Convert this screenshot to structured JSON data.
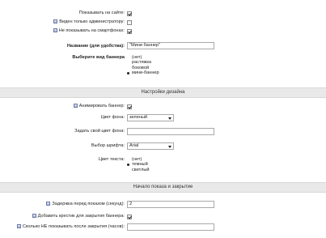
{
  "general": {
    "show_on_site_label": "Показывать на сайте:",
    "admin_only_label": "Виден только администратору:",
    "hide_on_phones_label": "Не показывать на смартфонах:",
    "name_label": "Название (для удобства):",
    "name_value": "\"Мини баннер\"",
    "banner_type_label": "Выберите вид баннера",
    "banner_type_options": [
      "(нет)",
      "растяжка",
      "боковой",
      "мини-баннер"
    ],
    "banner_type_selected": "мини-баннер"
  },
  "design": {
    "section_title": "Настройки дизайна",
    "animate_label": "Анимировать баннер:",
    "bg_color_label": "Цвет фона:",
    "bg_color_value": "зеленый",
    "custom_bg_label": "Задать свой цвет фона:",
    "custom_bg_value": "",
    "font_label": "Выбор шрифта:",
    "font_value": "Arial",
    "text_color_label": "Цвет текста:",
    "text_color_options": [
      "(нет)",
      "темный",
      "светлый"
    ],
    "text_color_selected": "темный"
  },
  "timing": {
    "section_title": "Начало показа и закрытие",
    "delay_label": "Задержка перед показом (секунд):",
    "delay_value": "2",
    "close_cross_label": "Добавить крестик для закрытия баннера:",
    "hide_after_close_label": "Сколько НЕ показывать после закрытия (часов):",
    "hide_after_close_value": ""
  }
}
